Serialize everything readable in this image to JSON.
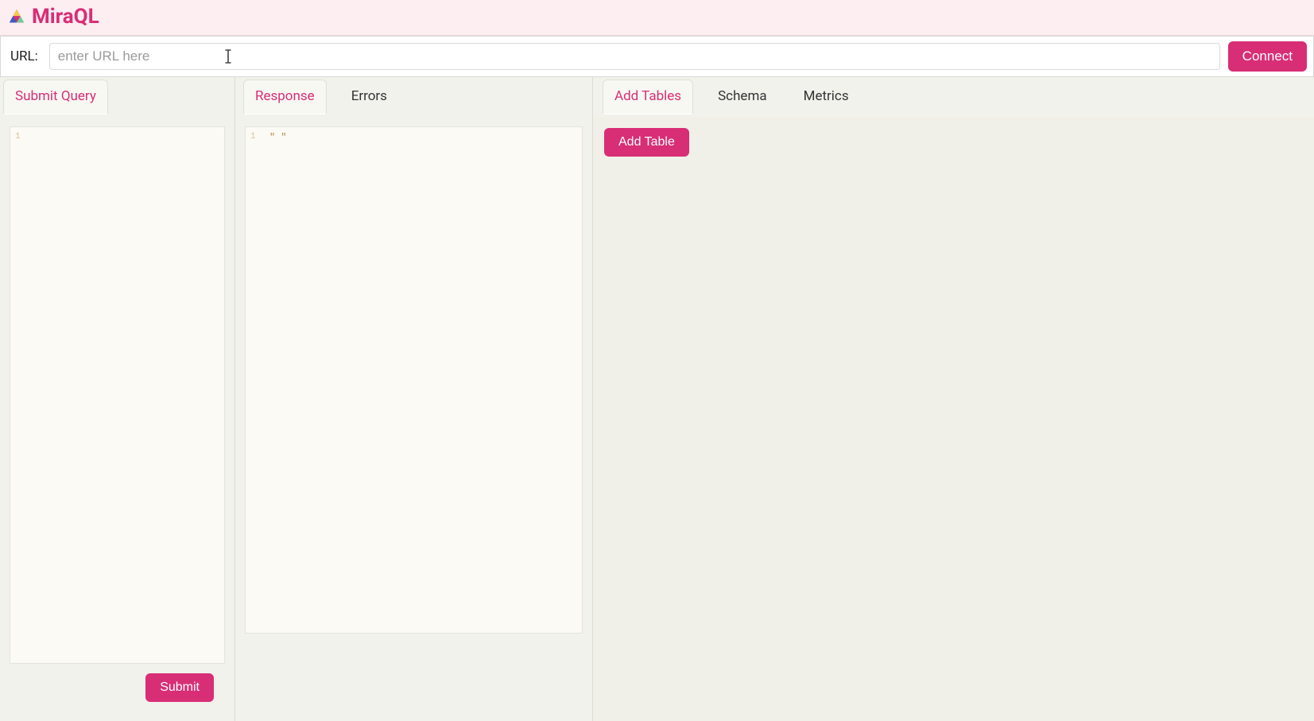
{
  "app": {
    "title": "MiraQL"
  },
  "urlbar": {
    "label": "URL:",
    "placeholder": "enter URL here",
    "value": "",
    "connect_label": "Connect"
  },
  "left_panel": {
    "tabs": [
      {
        "label": "Submit Query",
        "active": true
      }
    ],
    "editor": {
      "gutter_1": "1",
      "content_line1": ""
    },
    "submit_label": "Submit"
  },
  "middle_panel": {
    "tabs": [
      {
        "label": "Response",
        "active": true
      },
      {
        "label": "Errors",
        "active": false
      }
    ],
    "editor": {
      "gutter_1": "1",
      "content_line1": "\" \""
    }
  },
  "right_panel": {
    "tabs": [
      {
        "label": "Add Tables",
        "active": true
      },
      {
        "label": "Schema",
        "active": false
      },
      {
        "label": "Metrics",
        "active": false
      }
    ],
    "add_table_label": "Add Table"
  },
  "colors": {
    "accent": "#d82e76",
    "header_bg": "#fdeef2"
  }
}
